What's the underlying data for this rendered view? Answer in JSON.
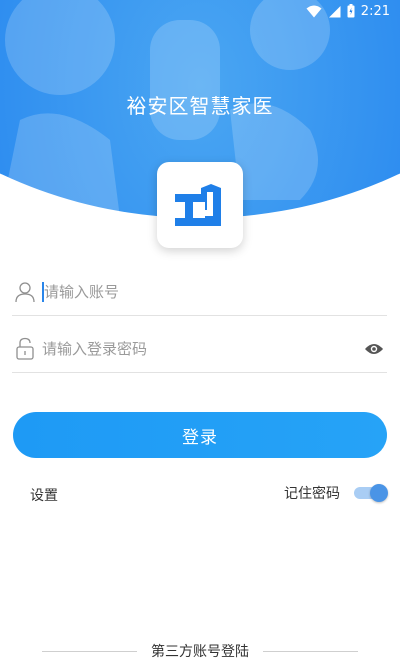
{
  "status_bar": {
    "time": "2:21",
    "icons": [
      "wifi-icon",
      "signal-icon",
      "battery-icon"
    ]
  },
  "header": {
    "title": "裕安区智慧家医"
  },
  "logo": {
    "icon": "house-logo-icon",
    "color": "#1f7fe8"
  },
  "account_field": {
    "placeholder": "请输入账号",
    "value": "",
    "icon": "user-icon"
  },
  "password_field": {
    "placeholder": "请输入登录密码",
    "value": "",
    "icon": "lock-icon",
    "toggle_icon": "eye-icon"
  },
  "login_button": {
    "label": "登录"
  },
  "settings": {
    "label": "设置"
  },
  "remember_password": {
    "label": "记住密码",
    "checked": true
  },
  "third_party": {
    "label": "第三方账号登陆"
  },
  "colors": {
    "primary": "#1e9af5",
    "header": "#1f7fe8",
    "toggle_on": "#4a94e6"
  }
}
